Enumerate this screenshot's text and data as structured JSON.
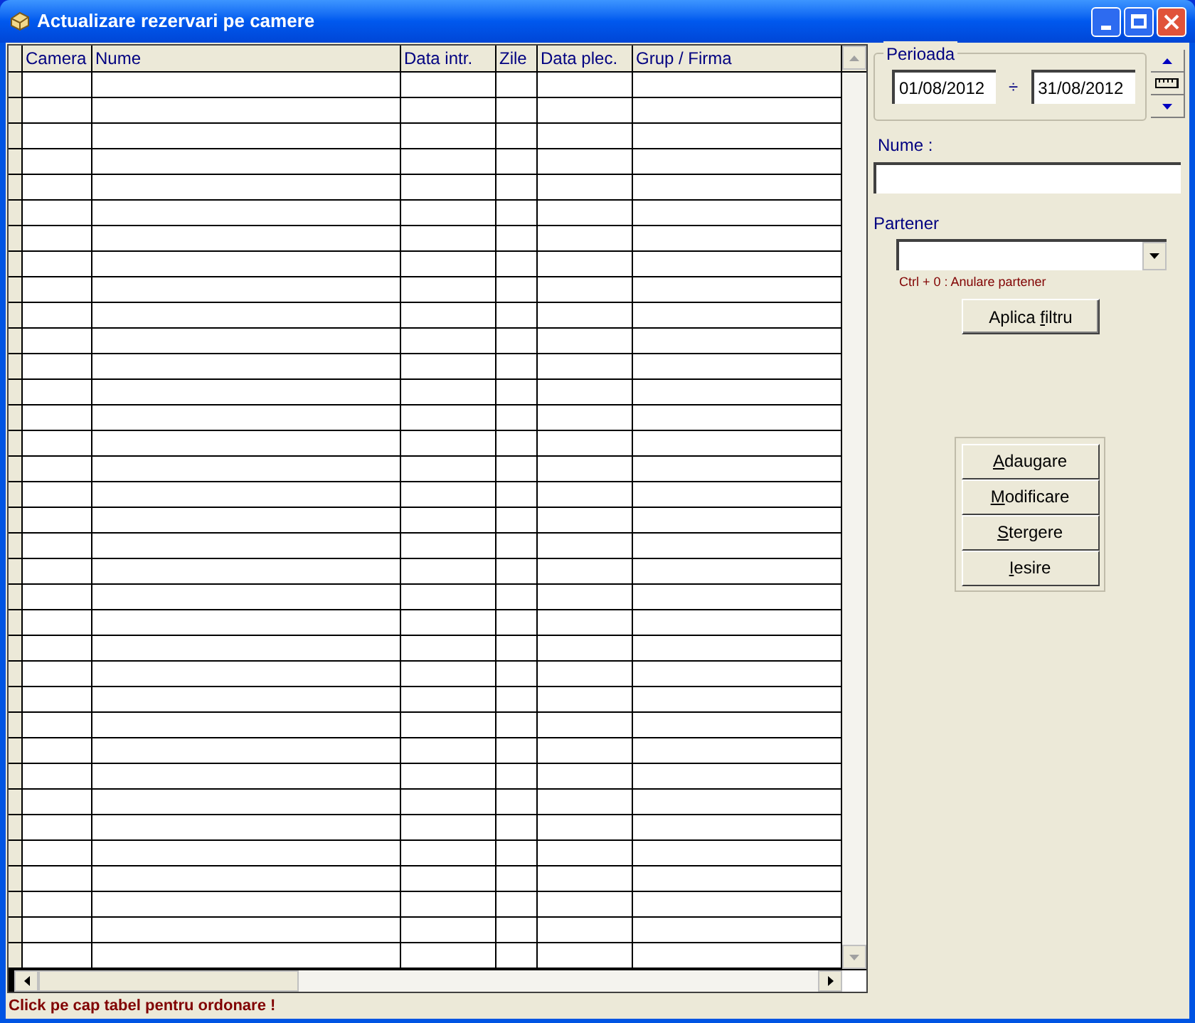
{
  "window": {
    "title": "Actualizare rezervari pe camere"
  },
  "table": {
    "columns": [
      "Camera",
      "Nume",
      "Data intr.",
      "Zile",
      "Data plec.",
      "Grup / Firma"
    ]
  },
  "filters": {
    "period_label": "Perioada",
    "date_from": "01/08/2012",
    "separator": "÷",
    "date_to": "31/08/2012",
    "name_label": "Nume :",
    "partner_label": "Partener",
    "partner_hint": "Ctrl + 0 : Anulare partener",
    "apply_button": {
      "before": "Aplica ",
      "accel": "f",
      "after": "iltru"
    }
  },
  "actions": [
    {
      "accel": "A",
      "after": "daugare"
    },
    {
      "accel": "M",
      "after": "odificare"
    },
    {
      "accel": "S",
      "after": "tergere"
    },
    {
      "accel": "I",
      "after": "esire"
    }
  ],
  "status_bar": "Click pe cap tabel pentru ordonare !"
}
